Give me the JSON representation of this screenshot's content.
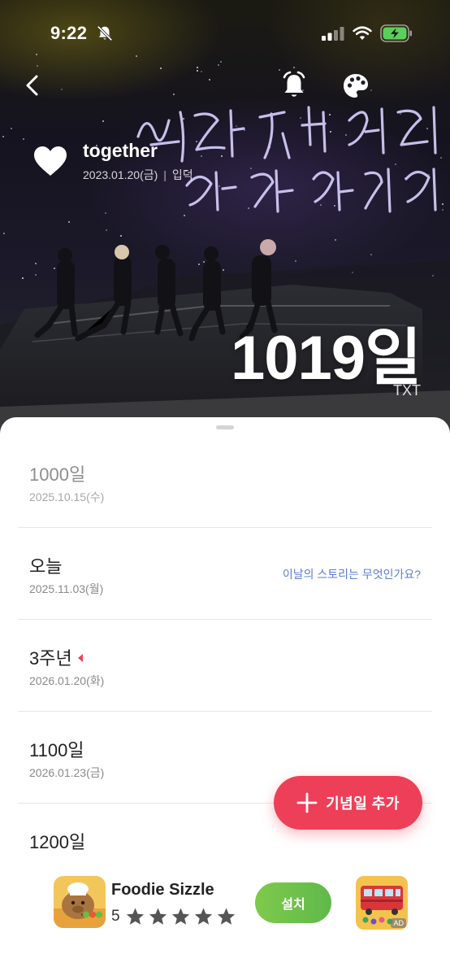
{
  "status_bar": {
    "time": "9:22",
    "icons": [
      "bell-off-icon",
      "signal-icon",
      "wifi-icon",
      "battery-charging-icon"
    ]
  },
  "header": {
    "icons": [
      "back-chevron-icon",
      "alarm-bell-icon",
      "palette-icon"
    ]
  },
  "event": {
    "icon": "heart-icon",
    "title": "together",
    "date": "2023.01.20(금)",
    "separator": "|",
    "tag": "입덕",
    "day_count": "1019일",
    "artist": "TXT"
  },
  "list": {
    "items": [
      {
        "label": "1000일",
        "date": "2025.10.15(수)"
      },
      {
        "label": "오늘",
        "date": "2025.11.03(월)",
        "link": "이날의 스토리는 무엇인가요?"
      },
      {
        "label": "3주년",
        "date": "2026.01.20(화)"
      },
      {
        "label": "1100일",
        "date": "2026.01.23(금)"
      },
      {
        "label": "1200일",
        "date": ""
      }
    ]
  },
  "add_button": {
    "label": "기념일 추가"
  },
  "ad": {
    "app_name": "Foodie Sizzle",
    "rating": "5",
    "stars": 5,
    "install_label": "설치",
    "badge": "AD"
  },
  "colors": {
    "accent": "#ee3f58",
    "link": "#5a7ed8",
    "install": "#6cc04a",
    "marker": "#e8465e"
  }
}
